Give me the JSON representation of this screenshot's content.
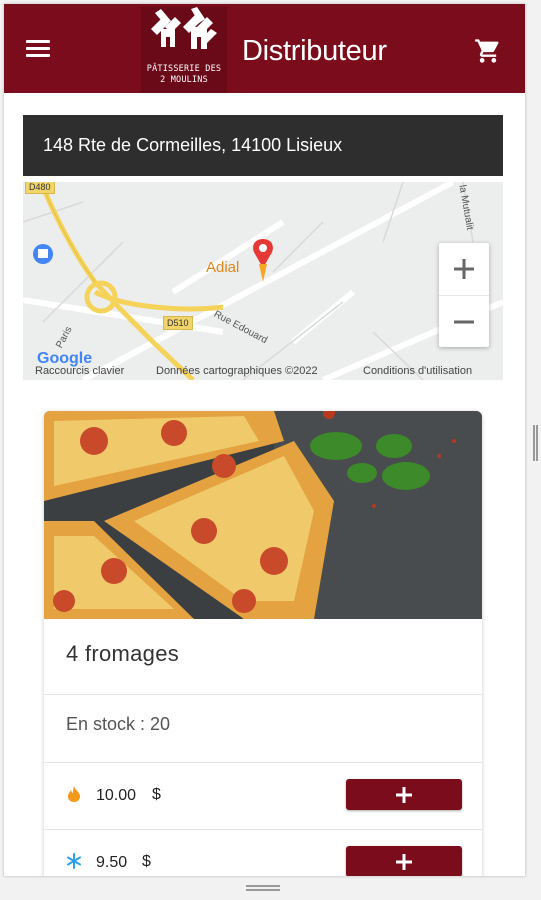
{
  "header": {
    "title": "Distributeur",
    "logo_line1": "PÂTISSERIE DES",
    "logo_line2": "2 MOULINS",
    "menu_icon": "hamburger-menu-icon",
    "cart_icon": "shopping-cart-icon",
    "background_color": "#7a0c1c"
  },
  "location": {
    "address": "148 Rte de Cormeilles, 14100 Lisieux"
  },
  "map": {
    "poi_name": "Adial",
    "road_tag_1": "D510",
    "road_tag_2": "D480",
    "road_name_1": "Rue Edouard",
    "road_name_2": "Paris",
    "road_name_3": "la Mutualit",
    "google_logo": "Google",
    "shortcuts": "Raccourcis clavier",
    "map_data": "Données cartographiques ©2022",
    "terms": "Conditions d'utilisation",
    "zoom_in_icon": "plus-icon",
    "zoom_out_icon": "minus-icon"
  },
  "product": {
    "name": "4 fromages",
    "stock_label": "En stock : 20",
    "prices": [
      {
        "icon": "flame-icon",
        "icon_color": "#f39a1c",
        "value": "10.00",
        "currency": "$"
      },
      {
        "icon": "snowflake-icon",
        "icon_color": "#2aa3e8",
        "value": "9.50",
        "currency": "$"
      }
    ],
    "add_icon": "plus-icon",
    "accent_color": "#7a0c1c"
  }
}
